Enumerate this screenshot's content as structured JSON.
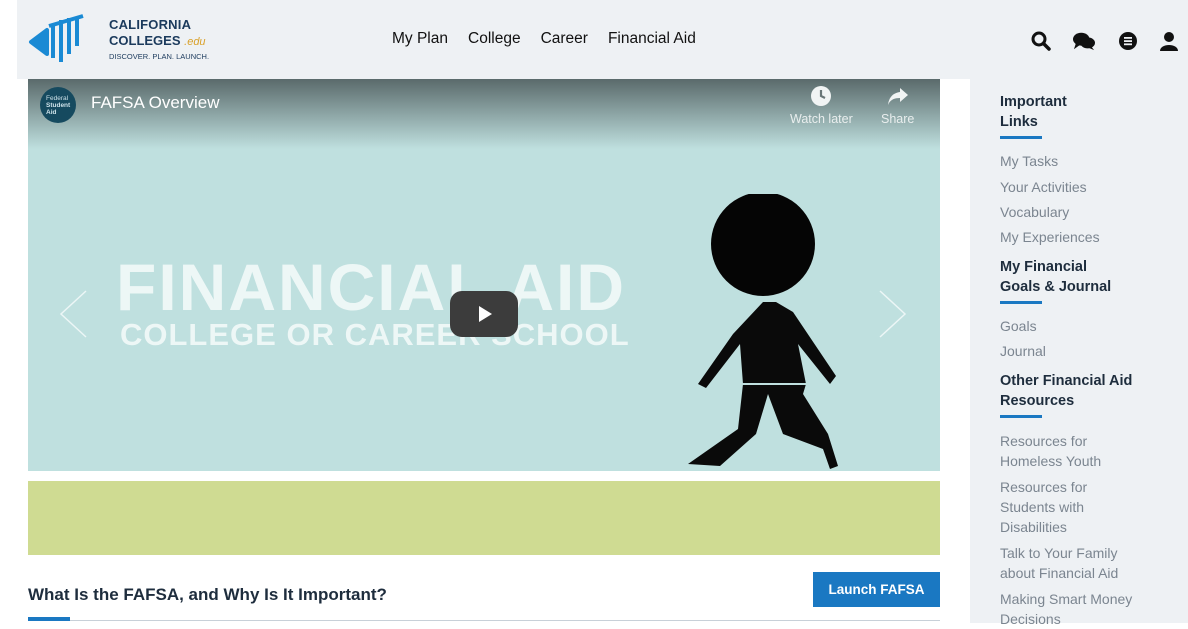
{
  "header": {
    "logo": {
      "line1": "CALIFORNIA",
      "line2": "COLLEGES",
      "line2_suffix": ".edu",
      "tagline": "DISCOVER. PLAN. LAUNCH."
    },
    "nav": [
      "My Plan",
      "College",
      "Career",
      "Financial Aid"
    ],
    "icons": [
      "search-icon",
      "chat-icon",
      "list-icon",
      "user-icon"
    ]
  },
  "video": {
    "channel_logo_text": [
      "Federal",
      "Student",
      "Aid"
    ],
    "title": "FAFSA Overview",
    "watch_later": "Watch later",
    "share": "Share",
    "overlay_line1": "FINANCIAL AID",
    "overlay_line2": "COLLEGE OR CAREER SCHOOL",
    "colors": {
      "background": "#bfe0df",
      "band": "#cfdb92"
    }
  },
  "main": {
    "section_title": "What Is the FAFSA, and Why Is It Important?",
    "launch_button": "Launch FAFSA"
  },
  "sidebar": {
    "important_links": {
      "heading_l1": "Important",
      "heading_l2": "Links",
      "items": [
        "My Tasks",
        "Your Activities",
        "Vocabulary",
        "My Experiences"
      ]
    },
    "goals": {
      "heading_l1": "My Financial",
      "heading_l2": "Goals & Journal",
      "items": [
        "Goals",
        "Journal"
      ]
    },
    "resources": {
      "heading_l1": "Other Financial Aid",
      "heading_l2": "Resources",
      "items": [
        {
          "l1": "Resources for",
          "l2": "Homeless Youth"
        },
        {
          "l1": "Resources for",
          "l2": "Students with",
          "l3": "Disabilities"
        },
        {
          "l1": "Talk to Your Family",
          "l2": "about Financial Aid"
        },
        {
          "l1": "Making Smart Money",
          "l2": "Decisions"
        }
      ]
    }
  },
  "colors": {
    "accent": "#1a78c2",
    "header_bg": "#eef1f4",
    "heading": "#1e2d3d",
    "link": "#7b8590"
  }
}
